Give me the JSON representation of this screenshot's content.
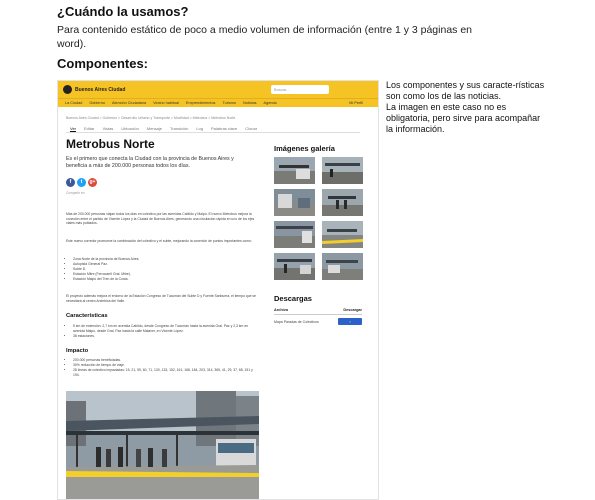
{
  "page": {
    "heading_when": "¿Cuándo la usamos?",
    "description": "Para contenido estático de poco a medio volumen de información (entre 1 y 3 páginas en word).",
    "heading_components": "Componentes:",
    "side_note": "Los componentes y sus caracte-rísticas son como los de las noticias.\nLa imagen en este caso no es obligatoria, pero sirve para acompañar la información."
  },
  "header": {
    "brand": "Buenos Aires Ciudad",
    "search_placeholder": "Buscar...",
    "login": "",
    "nav": [
      "La Ciudad",
      "Gobierno",
      "Atención Ciudadana",
      "Vecino habitual",
      "Emprendimientos",
      "Turismo",
      "Noticias",
      "Agenda"
    ],
    "user": "Mi Perfil"
  },
  "article": {
    "breadcrumb": "Buenos Aires Ciudad > Gobierno > Desarrollo Urbano y Transporte > Movilidad > Metrobus > Metrobus Norte",
    "tabs": [
      "Ver",
      "Editar",
      "Vistas",
      "Ubicación",
      "Mensaje",
      "Transición",
      "Log",
      "Palabras clave",
      "Clonar"
    ],
    "title": "Metrobus Norte",
    "lead": "Es el primero que conecta la Ciudad con la provincia de Buenos Aires y beneficia a más de 200.000 personas todos los días.",
    "social": [
      "f",
      "t",
      "g+"
    ],
    "share_label": "Compartir en:",
    "p1": "Más de 200.000 personas viajan todos los días en colectivo por las avenidas Cabildo y Maipú. El nuevo Metrobus mejora la conexión entre el partido de Vicente López y la Ciudad de Buenos Aires, generando una circulación rápida en uno de los ejes viales más poblados.",
    "p2": "Este nuevo corredor promueve la combinación del colectivo y el subte, mejorando la conexión de puntos importantes como:",
    "list1": [
      "Zona Norte de la provincia de Buenos Aires.",
      "Autopista General Paz.",
      "Subte D.",
      "Estación Mitre (Ferrocarril Gral. Mitre).",
      "Estación Maipú del Tren de la Costa."
    ],
    "p3": "El proyecto además mejora el entorno de la Estación Congreso de Tucumán del Subte D y Fuente Sanbuera, el tiempo que se necesitará al centro Anímbica del Valle.",
    "h_features": "Características",
    "list2": [
      "5 km de extensión: 2,7 km en avenida Cabildo, desde Congreso de Tucumán hasta la avenida Gral. Paz y 2,3 km en avenida Maipú, desde Gral. Paz hasta la calle Malaver, en Vicente López.",
      "38 estaciones."
    ],
    "h_impact": "Impacto",
    "list3": [
      "200.000 personas beneficiadas.",
      "30% reducción de tiempo de viaje.",
      "28 líneas de colectivo impactadas: 15, 21, 59, 60, 71, 130, 133, 152, 161, 168, 184, 203, 314, 365, 41, 29, 37, 68, 151 y 194."
    ]
  },
  "gallery": {
    "heading": "Imágenes galería"
  },
  "downloads": {
    "heading": "Descargas",
    "col_file": "Archivo",
    "col_action": "Descargar",
    "file": "Mapa Paradas de Colectivos",
    "button": ""
  }
}
